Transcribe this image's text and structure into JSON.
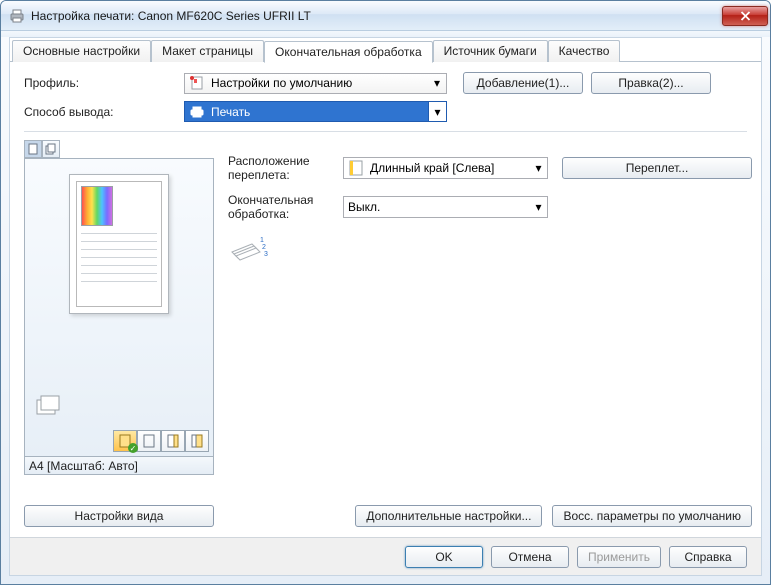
{
  "window": {
    "title": "Настройка печати: Canon MF620C Series UFRII LT"
  },
  "tabs": {
    "items": [
      "Основные настройки",
      "Макет страницы",
      "Окончательная обработка",
      "Источник бумаги",
      "Качество"
    ],
    "active_index": 2
  },
  "top": {
    "profile_label": "Профиль:",
    "profile_value": "Настройки по умолчанию",
    "add_button": "Добавление(1)...",
    "edit_button": "Правка(2)...",
    "output_label": "Способ вывода:",
    "output_value": "Печать"
  },
  "preview": {
    "caption": "A4 [Масштаб: Авто]",
    "view_settings_button": "Настройки вида"
  },
  "fields": {
    "binding_label": "Расположение переплета:",
    "binding_value": "Длинный край [Слева]",
    "binding_button": "Переплет...",
    "finishing_label": "Окончательная обработка:",
    "finishing_value": "Выкл."
  },
  "bottom_right": {
    "advanced_button": "Дополнительные настройки...",
    "restore_button": "Восс. параметры по умолчанию"
  },
  "footer": {
    "ok": "OK",
    "cancel": "Отмена",
    "apply": "Применить",
    "help": "Справка"
  }
}
